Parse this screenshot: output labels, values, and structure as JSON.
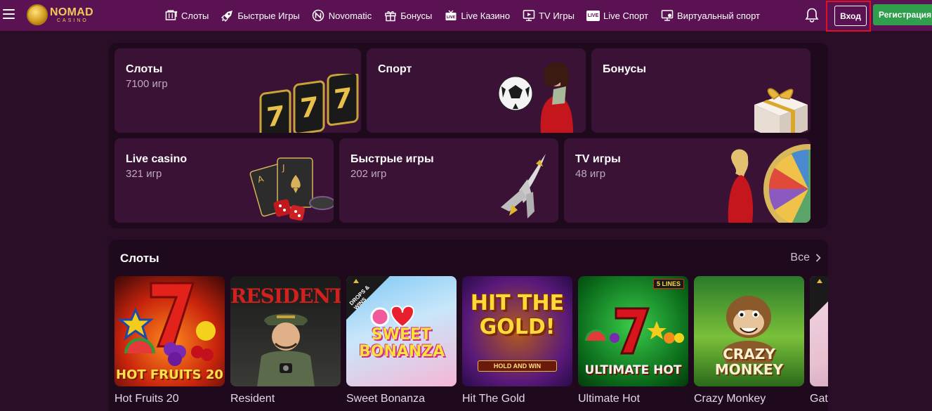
{
  "header": {
    "logo_main": "NOMAD",
    "logo_sub": "CASINO",
    "nav": [
      {
        "label": "Слоты",
        "icon": "slot-machine-icon"
      },
      {
        "label": "Быстрые Игры",
        "icon": "rocket-icon"
      },
      {
        "label": "Novomatic",
        "icon": "novomatic-icon"
      },
      {
        "label": "Бонусы",
        "icon": "gift-icon"
      },
      {
        "label": "Live Казино",
        "icon": "live-tv-icon"
      },
      {
        "label": "TV Игры",
        "icon": "tv-icon"
      },
      {
        "label": "Live Спорт",
        "icon": "live-badge-icon",
        "badge": "LIVE"
      },
      {
        "label": "Виртуальный спорт",
        "icon": "monitor-icon"
      }
    ],
    "login_label": "Вход",
    "register_label": "Регистрация"
  },
  "categories": [
    {
      "title": "Слоты",
      "count": "7100 игр"
    },
    {
      "title": "Спорт",
      "count": ""
    },
    {
      "title": "Бонусы",
      "count": ""
    },
    {
      "title": "Live casino",
      "count": "321 игр"
    },
    {
      "title": "Быстрые игры",
      "count": "202 игр"
    },
    {
      "title": "TV игры",
      "count": "48 игр"
    }
  ],
  "slots": {
    "title": "Слоты",
    "all_label": "Все",
    "games": [
      {
        "name": "Hot Fruits 20",
        "thumb_text": "HOT FRUITS 20"
      },
      {
        "name": "Resident",
        "thumb_text": "RESIDENT"
      },
      {
        "name": "Sweet Bonanza",
        "thumb_text": "SWEET BONANZA"
      },
      {
        "name": "Hit The Gold",
        "thumb_text": "HIT THE GOLD!"
      },
      {
        "name": "Ultimate Hot",
        "thumb_text": "ULTIMATE HOT"
      },
      {
        "name": "Crazy Monkey",
        "thumb_text": "CRAZY MONKEY"
      },
      {
        "name": "Gates of Olympus",
        "thumb_text": ""
      }
    ],
    "badges": {
      "drops_wins": "DROPS & WINS",
      "lines": "5 LINES",
      "hold_win": "HOLD AND WIN"
    }
  },
  "colors": {
    "header_bg": "#5a1253",
    "page_bg": "#2a0d26",
    "card_bg": "#3a1235",
    "register_green": "#2f9e4d",
    "highlight_red": "#e0101c"
  }
}
